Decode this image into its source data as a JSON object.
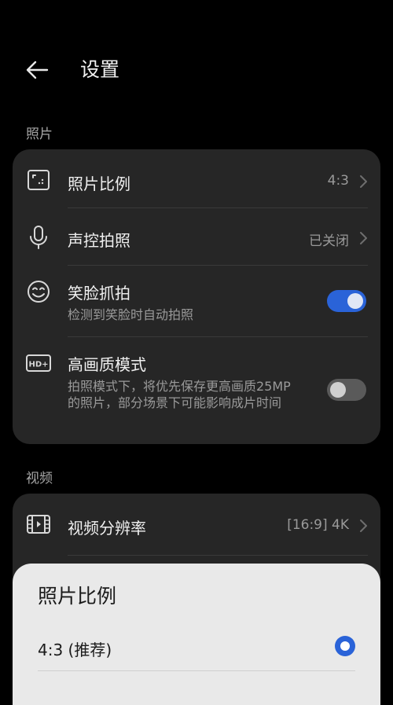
{
  "header": {
    "title": "设置"
  },
  "sections": {
    "photo": "照片",
    "video": "视频"
  },
  "photo_items": {
    "ratio": {
      "label": "照片比例",
      "value": "4:3"
    },
    "voice": {
      "label": "声控拍照",
      "value": "已关闭"
    },
    "smile": {
      "label": "笑脸抓拍",
      "desc": "检测到笑脸时自动拍照",
      "toggle": "on"
    },
    "hq": {
      "label": "高画质模式",
      "desc": "拍照模式下，将优先保存更高画质25MP 的照片，部分场景下可能影响成片时间",
      "toggle": "off"
    }
  },
  "video_items": {
    "resolution": {
      "label": "视频分辨率",
      "value": "[16:9] 4K"
    }
  },
  "sheet": {
    "title": "照片比例",
    "selected_option": "4:3 (推荐)"
  },
  "colors": {
    "accent": "#2a63d8",
    "card": "#262626",
    "background": "#000000"
  },
  "icons": [
    "back-arrow-icon",
    "aspect-ratio-icon",
    "microphone-icon",
    "smile-icon",
    "hd-plus-icon",
    "video-frame-icon",
    "chevron-right-icon"
  ]
}
